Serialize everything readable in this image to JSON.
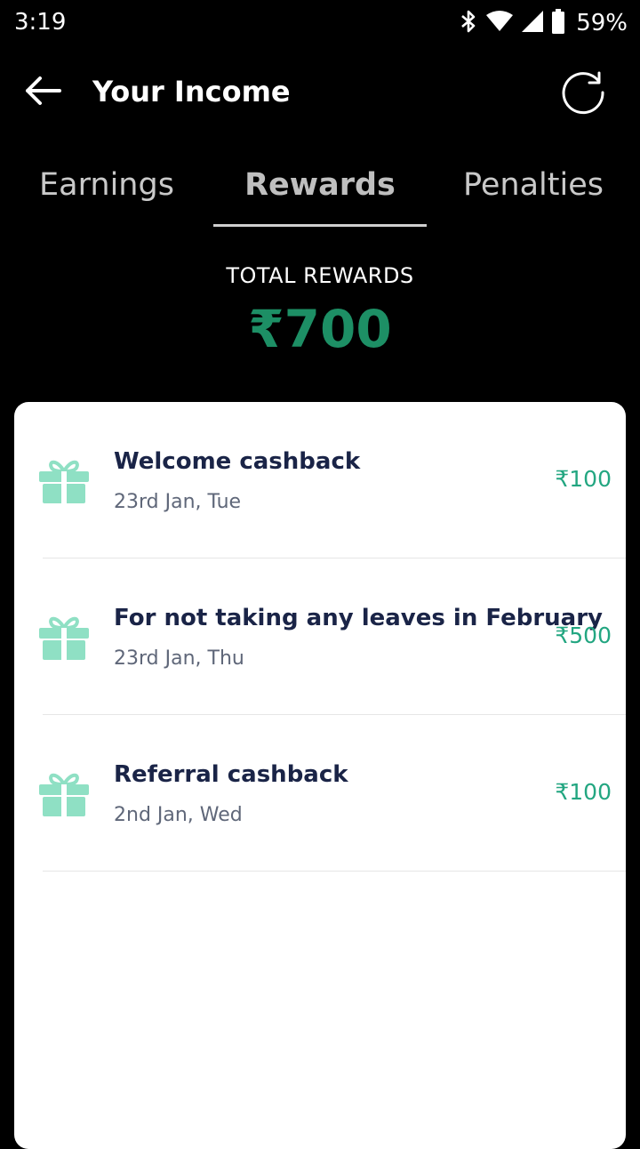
{
  "status_bar": {
    "time": "3:19",
    "battery": "59%"
  },
  "header": {
    "title": "Your Income"
  },
  "tabs": [
    {
      "label": "Earnings",
      "active": false
    },
    {
      "label": "Rewards",
      "active": true
    },
    {
      "label": "Penalties",
      "active": false
    }
  ],
  "total": {
    "label": "TOTAL REWARDS",
    "value": "₹700"
  },
  "rewards": [
    {
      "title": "Welcome cashback",
      "date": "23rd Jan, Tue",
      "amount": "₹100"
    },
    {
      "title": "For not taking any leaves in February",
      "date": "23rd Jan, Thu",
      "amount": "₹500"
    },
    {
      "title": "Referral cashback",
      "date": "2nd Jan, Wed",
      "amount": "₹100"
    }
  ],
  "icons": [
    "back-arrow-icon",
    "refresh-icon",
    "gift-icon",
    "bluetooth-icon",
    "wifi-icon",
    "signal-icon",
    "battery-icon"
  ],
  "colors": {
    "accent": "#1d8f65",
    "amount": "#23a681",
    "gift": "#8fe0c4",
    "title": "#1a2447",
    "background": "#000000",
    "card": "#ffffff"
  }
}
